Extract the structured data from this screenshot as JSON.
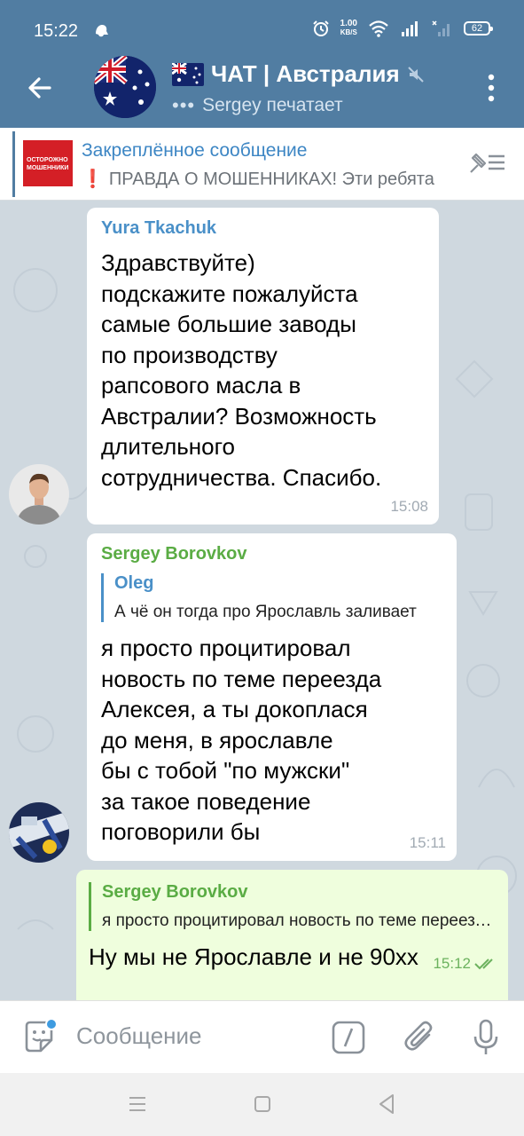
{
  "status_bar": {
    "time": "15:22",
    "speed_value": "1.00",
    "speed_unit": "KB/S",
    "battery": "62"
  },
  "header": {
    "title": "ЧАТ | Австралия",
    "typing_user": "Sergey печатает",
    "flag_emoji": "🇦🇺"
  },
  "pinned": {
    "label": "Закреплённое сообщение",
    "exclamation": "❗",
    "text": "ПРАВДА О МОШЕННИКАХ!  Эти ребята",
    "thumb_text": "ОСТОРОЖНО МОШЕННИКИ"
  },
  "messages": [
    {
      "sender": "Yura Tkachuk",
      "lines": [
        "Здравствуйте)",
        "подскажите пожалуйста",
        "самые большие заводы",
        "по производству",
        "рапсового масла в",
        "Австралии? Возможность",
        "длительного",
        "сотрудничества. Спасибо."
      ],
      "time": "15:08"
    },
    {
      "sender": "Sergey Borovkov",
      "reply_name": "Oleg",
      "reply_text": "А чё он тогда про Ярославль заливает",
      "lines": [
        "я просто процитировал",
        "новость по теме переезда",
        "Алексея, а ты докоплася",
        "до меня, в ярославле",
        "бы с тобой \"по мужски\"",
        "за такое поведение",
        "поговорили бы"
      ],
      "time": "15:11"
    },
    {
      "reply_name": "Sergey Borovkov",
      "reply_text": "я просто процитировал новость по теме переезда",
      "text": "Ну мы не Ярославле и не 90хх",
      "time": "15:12"
    }
  ],
  "input": {
    "placeholder": "Сообщение"
  },
  "colors": {
    "header": "#517da2",
    "chat_bg": "#cfd8df",
    "outgoing_bubble": "#effedd",
    "link_blue": "#4a90c8",
    "green_name": "#5aac44"
  }
}
